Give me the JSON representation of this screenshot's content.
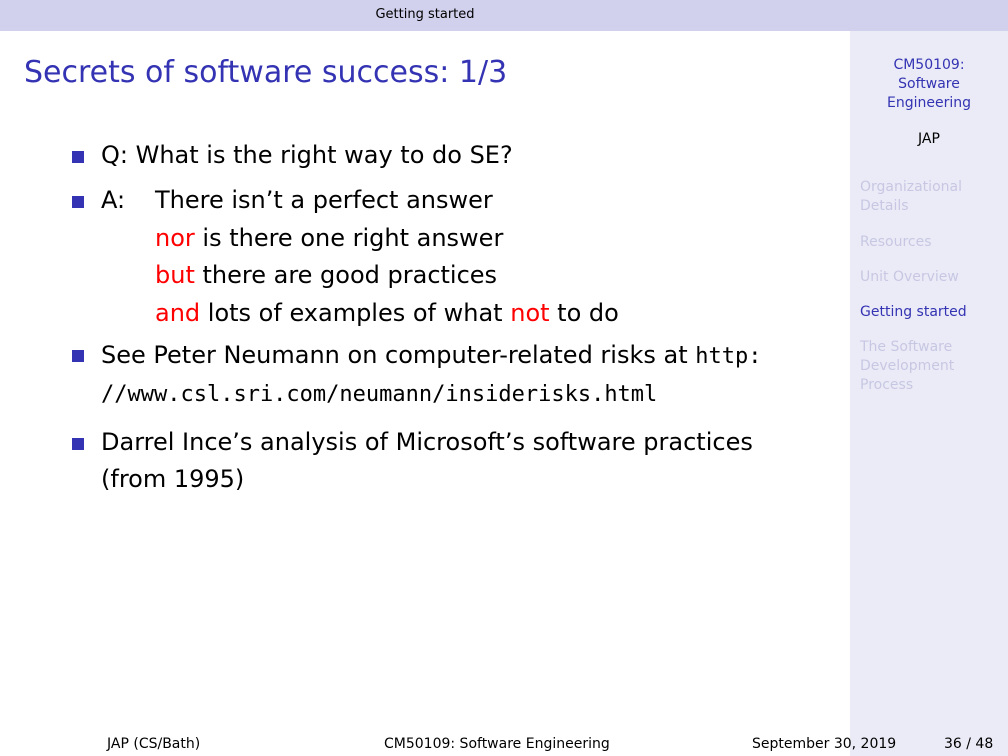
{
  "headline": {
    "section": "Getting started"
  },
  "sidebar": {
    "course": [
      "CM50109:",
      "Software",
      "Engineering"
    ],
    "author": "JAP",
    "items": [
      {
        "lines": [
          "Organizational",
          "Details"
        ],
        "active": false
      },
      {
        "lines": [
          "Resources"
        ],
        "active": false
      },
      {
        "lines": [
          "Unit Overview"
        ],
        "active": false
      },
      {
        "lines": [
          "Getting started"
        ],
        "active": true
      },
      {
        "lines": [
          "The Software",
          "Development",
          "Process"
        ],
        "active": false
      }
    ]
  },
  "slide": {
    "title": "Secrets of software success: 1/3",
    "q_line": "Q: What is the right way to do SE?",
    "a_prefix": "A:",
    "a_line1": "There isn’t a perfect answer",
    "a_line2_red": "nor",
    "a_line2_rest": " is there one right answer",
    "a_line3_red": "but",
    "a_line3_rest": " there are good practices",
    "a_line4_red1": "and",
    "a_line4_mid": " lots of examples of what ",
    "a_line4_red2": "not",
    "a_line4_end": " to do",
    "neumann_text": "See Peter Neumann on computer-related risks at ",
    "neumann_url1": "http:",
    "neumann_url2": "//www.csl.sri.com/neumann/insiderisks.html",
    "ince_line1": "Darrel Ince’s analysis of Microsoft’s software practices",
    "ince_line2": "(from 1995)"
  },
  "footer": {
    "author": "JAP  (CS/Bath)",
    "course": "CM50109: Software Engineering",
    "date": "September 30, 2019",
    "page": "36 / 48"
  },
  "colors": {
    "structure": "#3333b3",
    "alert": "#ff0000",
    "headline_bg": "#d1d1ee",
    "sidebar_bg": "#ebebf7",
    "sidebar_inactive": "#c7c7e3"
  }
}
